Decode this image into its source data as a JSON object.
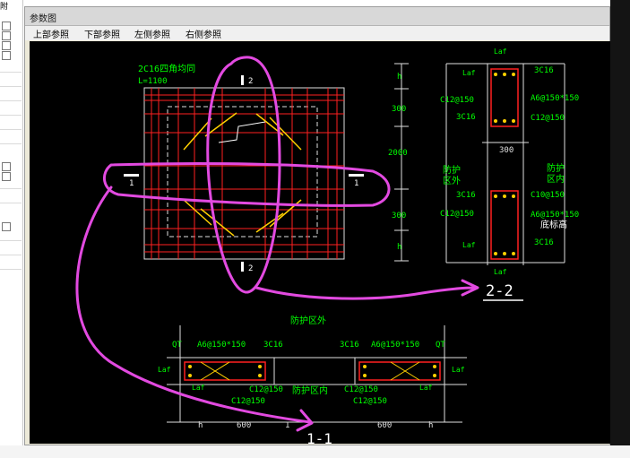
{
  "window": {
    "title": "参数图"
  },
  "corner_text": "附",
  "toolbar": {
    "top": "上部参照",
    "bottom": "下部参照",
    "left": "左侧参照",
    "right": "右侧参照"
  },
  "plan": {
    "rebar_note": "2C16四角均同",
    "length_note": "L=1100",
    "mark_1": "1",
    "mark_2": "2"
  },
  "section22": {
    "dims": [
      "h",
      "300",
      "2000",
      "300",
      "h"
    ],
    "laf": "Laf",
    "bar_3c16": "3C16",
    "c12_150": "C12@150",
    "a6_150": "A6@150*150",
    "c10_150": "C10@150",
    "w300": "300",
    "outside_1": "防护",
    "outside_2": "区外",
    "inside_1": "防护",
    "inside_2": "区内",
    "base_label": "底标高",
    "title": "2-2"
  },
  "section11": {
    "outside": "防护区外",
    "inside": "防护区内",
    "qt": "QT",
    "a6": "A6@150*150",
    "c16": "3C16",
    "laf": "Laf",
    "c12": "C12@150",
    "h": "h",
    "d600": "600",
    "d1": "1",
    "title": "1-1"
  },
  "colors": {
    "annotation": "#e24ae0",
    "rebar_green": "#00ff00",
    "dim_white": "#ffffff",
    "grid_red": "#ff2020",
    "hatch_yellow": "#ffd000"
  }
}
